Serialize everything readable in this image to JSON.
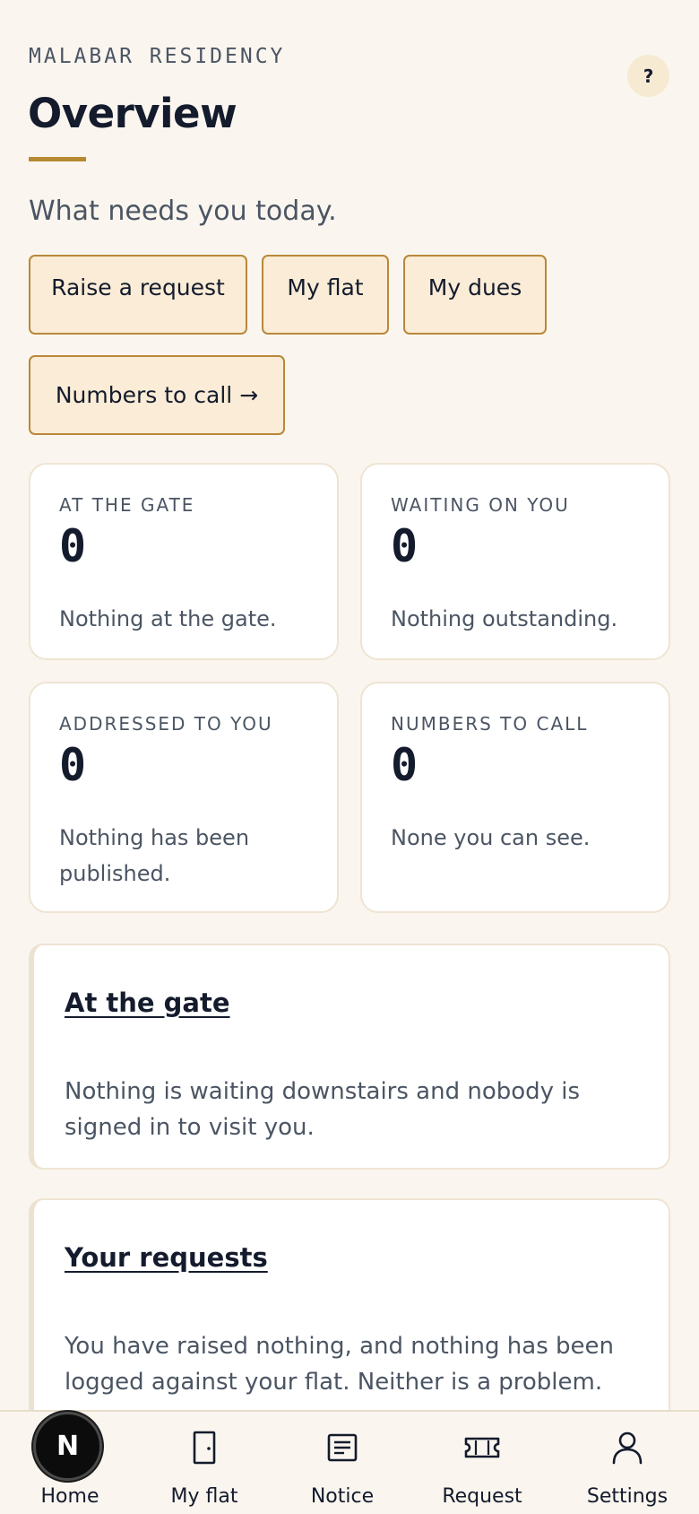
{
  "header": {
    "brand": "MALABAR RESIDENCY",
    "help_label": "?",
    "title": "Overview",
    "subtitle": "What needs you today."
  },
  "quick_actions": [
    {
      "label": "Raise a request"
    },
    {
      "label": "My flat"
    },
    {
      "label": "My dues"
    },
    {
      "label": "Numbers to call →"
    }
  ],
  "stats": [
    {
      "label": "AT THE GATE",
      "value": "0",
      "note": "Nothing at the gate."
    },
    {
      "label": "WAITING ON YOU",
      "value": "0",
      "note": "Nothing outstanding."
    },
    {
      "label": "ADDRESSED TO YOU",
      "value": "0",
      "note": "Nothing has been published."
    },
    {
      "label": "NUMBERS TO CALL",
      "value": "0",
      "note": "None you can see."
    }
  ],
  "panels": [
    {
      "title": "At the gate",
      "body": "Nothing is waiting downstairs and nobody is signed in to visit you."
    },
    {
      "title": "Your requests",
      "body": "You have raised nothing, and nothing has been logged against your flat. Neither is a problem."
    }
  ],
  "nav": [
    {
      "label": "Home",
      "icon": "home-icon"
    },
    {
      "label": "My flat",
      "icon": "door-icon"
    },
    {
      "label": "Notice",
      "icon": "notice-icon"
    },
    {
      "label": "Request",
      "icon": "ticket-icon"
    },
    {
      "label": "Settings",
      "icon": "user-icon"
    }
  ],
  "fab_letter": "N",
  "colors": {
    "background": "#faf6ef",
    "accent": "#b58a30",
    "action_fill": "#faecd6",
    "text_primary": "#141b2d",
    "text_secondary": "#4b5563"
  }
}
